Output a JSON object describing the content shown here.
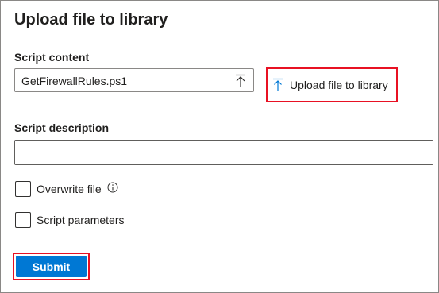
{
  "dialog": {
    "title": "Upload file to library"
  },
  "script_content": {
    "label": "Script content",
    "file_value": "GetFirewallRules.ps1",
    "upload_link_label": "Upload file to library",
    "upload_icon": "upload-arrow-icon"
  },
  "script_description": {
    "label": "Script description",
    "value": ""
  },
  "options": {
    "overwrite_label": "Overwrite file",
    "overwrite_checked": false,
    "info_icon": "info-circle-icon",
    "parameters_label": "Script parameters",
    "parameters_checked": false
  },
  "actions": {
    "submit_label": "Submit"
  },
  "colors": {
    "accent": "#0078d4",
    "highlight_border": "#e81123",
    "text": "#201f1e"
  }
}
